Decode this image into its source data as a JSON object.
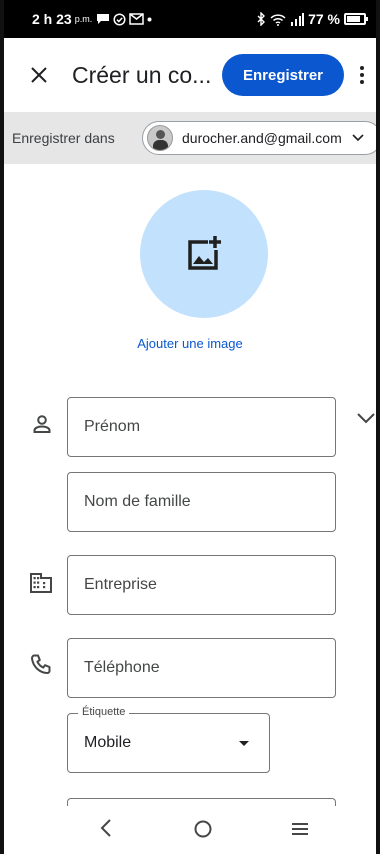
{
  "status_bar": {
    "time": "2 h 23",
    "time_suffix": "p.m.",
    "left_icons": [
      "chat-icon",
      "check-circle-icon",
      "gmail-icon",
      "dot-icon"
    ],
    "right_icons": [
      "bluetooth-icon",
      "wifi-icon",
      "signal-icon",
      "battery-icon"
    ],
    "battery_percent": "77 %"
  },
  "top_bar": {
    "close_icon": "close-icon",
    "title": "Créer un co...",
    "save_label": "Enregistrer",
    "menu_icon": "more-vert-icon"
  },
  "save_in": {
    "label": "Enregistrer dans",
    "account_email": "durocher.and@gmail.com",
    "dropdown_icon": "chevron-down-icon"
  },
  "photo": {
    "icon": "add-photo-icon",
    "link_label": "Ajouter une image"
  },
  "form": {
    "first_name_placeholder": "Prénom",
    "last_name_placeholder": "Nom de famille",
    "company_placeholder": "Entreprise",
    "phone_placeholder": "Téléphone",
    "phone_label_legend": "Étiquette",
    "phone_label_value": "Mobile"
  },
  "nav_bar": {
    "back_icon": "back-icon",
    "home_icon": "home-icon",
    "recents_icon": "recents-icon"
  },
  "colors": {
    "accent": "#0b57d0",
    "avatar_bg": "#c2e1fc",
    "save_bar_bg": "#e6e6e6"
  }
}
